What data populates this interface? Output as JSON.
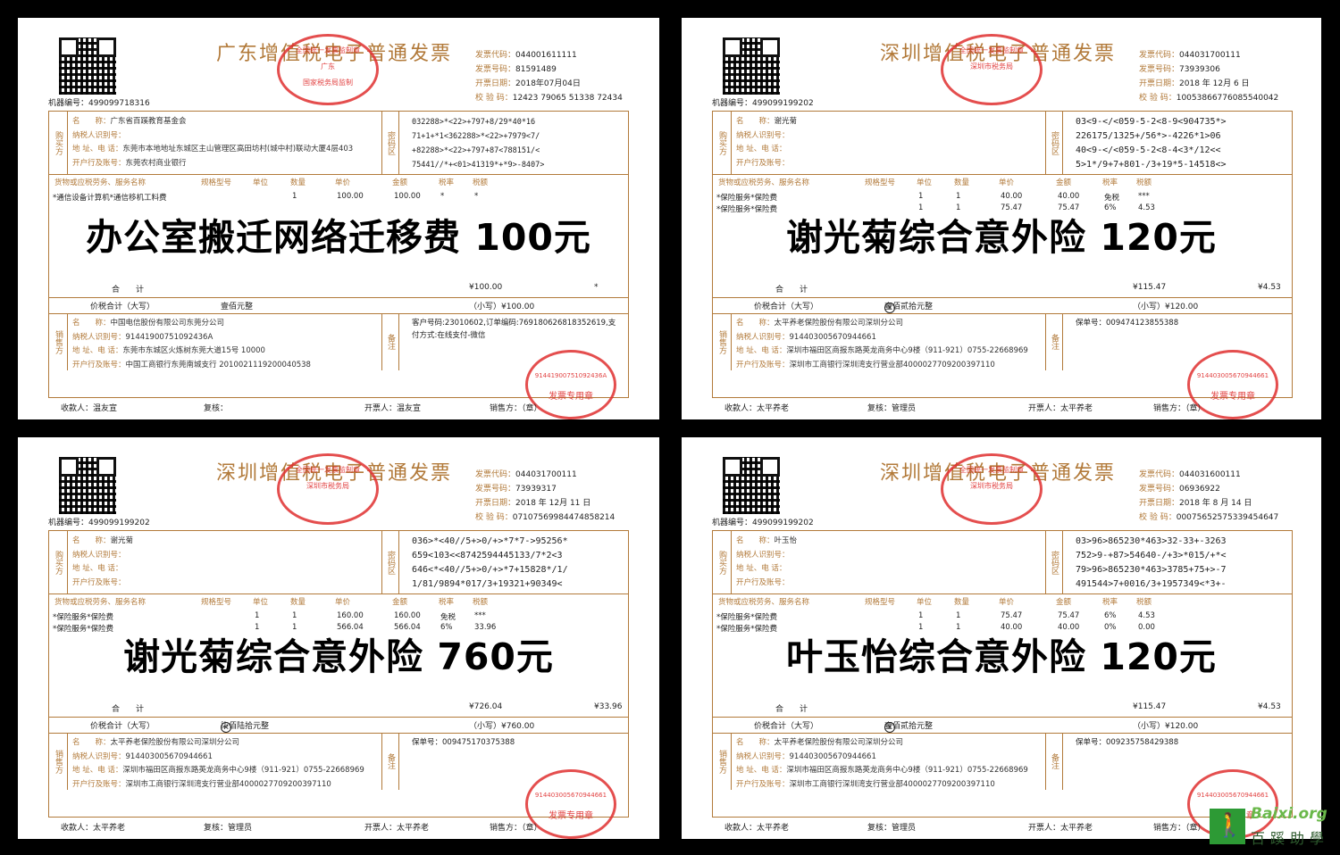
{
  "invoices": [
    {
      "title": "广东增值税电子普通发票",
      "seal_top_lines": [
        "全国统一发票监制章",
        "广东",
        "国家税务局监制"
      ],
      "machine_no": "机器编号：499099718316",
      "meta": [
        {
          "k": "发票代码：",
          "v": "044001611111"
        },
        {
          "k": "发票号码：",
          "v": "81591489"
        },
        {
          "k": "开票日期：",
          "v": "2018年07月04日"
        },
        {
          "k": "校 验 码：",
          "v": "12423 79065 51338 72434"
        }
      ],
      "buyer_label": "购买方",
      "buyer": [
        {
          "k": "名　　称：",
          "v": "广东省百蹊教育基金会"
        },
        {
          "k": "纳税人识别号：",
          "v": ""
        },
        {
          "k": "地 址、电 话：",
          "v": "东莞市本地地址东城区主山管理区高田坊村(城中村)联动大厦4层403"
        },
        {
          "k": "开户行及账号：",
          "v": "东莞农村商业银行"
        }
      ],
      "mi_label": "密码区",
      "cipher": [
        "032288>*<22>+797+8/29*40*16",
        "71+1+*1<362288>*<22>+7979<7/",
        "+82288>*<22>+797+87<788151/<",
        "75441//*+<01>41319*+*9>-8407>"
      ],
      "headers": [
        "货物或应税劳务、服务名称",
        "规格型号",
        "单位",
        "数量",
        "单价",
        "金额",
        "税率",
        "税额"
      ],
      "items": [
        [
          "*通信设备计算机*通信移机工料费",
          "",
          "",
          "1",
          "100.00",
          "100.00",
          "*",
          "*"
        ]
      ],
      "total_label": "合　　计",
      "total_amount": "¥100.00",
      "total_tax": "*",
      "sum_label": "价税合计（大写）",
      "sum_words": "壹佰元整",
      "sum_small": "（小写）¥100.00",
      "seller_label": "销售方",
      "seller": [
        {
          "k": "名　　称：",
          "v": "中国电信股份有限公司东莞分公司"
        },
        {
          "k": "纳税人识别号：",
          "v": "91441900751092436A"
        },
        {
          "k": "地 址、电 话：",
          "v": "东莞市东城区火炼树东莞大道15号 10000"
        },
        {
          "k": "开户行及账号：",
          "v": "中国工商银行东莞南城支行 2010021119200040538"
        }
      ],
      "remark_label": "备注",
      "remark": "客户号码:23010602,订单编码:769180626818352619,支付方式:在线支付-微信",
      "footer": [
        "收款人：温友宣",
        "复核：",
        "开票人：温友宣",
        "销售方：（章）"
      ],
      "seal_bot": [
        "91441900751092436A",
        "发票专用章"
      ],
      "overlay": "办公室搬迁网络迁移费 100元"
    },
    {
      "title": "深圳增值税电子普通发票",
      "seal_top_lines": [
        "全国统一发票监制章",
        "深圳市税务局"
      ],
      "machine_no": "机器编号：499099199202",
      "meta": [
        {
          "k": "发票代码：",
          "v": "044031700111"
        },
        {
          "k": "发票号码：",
          "v": "73939306"
        },
        {
          "k": "开票日期：",
          "v": "2018 年 12月 6 日"
        },
        {
          "k": "校 验 码：",
          "v": "10053866776085540042"
        }
      ],
      "buyer_label": "购买方",
      "buyer": [
        {
          "k": "名　　称：",
          "v": "谢光菊"
        },
        {
          "k": "纳税人识别号：",
          "v": ""
        },
        {
          "k": "地 址、电 话：",
          "v": ""
        },
        {
          "k": "开户行及账号：",
          "v": ""
        }
      ],
      "mi_label": "密码区",
      "cipher": [
        "03<9-</<059-5-2<8-9<904735*>",
        "226175/1325+/56*>-4226*1>06",
        "40<9-</<059-5-2<8-4<3*/12<<",
        "5>1*/9+7+801-/3+19*5-14518<>"
      ],
      "headers": [
        "货物或应税劳务、服务名称",
        "规格型号",
        "单位",
        "数量",
        "单价",
        "金额",
        "税率",
        "税额"
      ],
      "items": [
        [
          "*保险服务*保险费",
          "",
          "1",
          "1",
          "40.00",
          "40.00",
          "免税",
          "***"
        ],
        [
          "*保险服务*保险费",
          "",
          "1",
          "1",
          "75.47",
          "75.47",
          "6%",
          "4.53"
        ]
      ],
      "total_label": "合　　计",
      "total_amount": "¥115.47",
      "total_tax": "¥4.53",
      "sum_label": "价税合计（大写）",
      "sum_words": "壹佰贰拾元整",
      "sum_small": "（小写）¥120.00",
      "seller_label": "销售方",
      "seller": [
        {
          "k": "名　　称：",
          "v": "太平养老保险股份有限公司深圳分公司"
        },
        {
          "k": "纳税人识别号：",
          "v": "914403005670944661"
        },
        {
          "k": "地 址、电 话：",
          "v": "深圳市福田区商报东路英龙商务中心9楼（911-921）0755-22668969"
        },
        {
          "k": "开户行及账号：",
          "v": "深圳市工商银行深圳湾支行营业部4000027709200397110"
        }
      ],
      "remark_label": "备注",
      "remark": "保单号：009474123855388",
      "footer": [
        "收款人：太平养老",
        "复核：管理员",
        "开票人：太平养老",
        "销售方：（章）"
      ],
      "seal_bot": [
        "914403005670944661",
        "发票专用章"
      ],
      "overlay": "谢光菊综合意外险 120元"
    },
    {
      "title": "深圳增值税电子普通发票",
      "seal_top_lines": [
        "全国统一发票监制章",
        "深圳市税务局"
      ],
      "machine_no": "机器编号：499099199202",
      "meta": [
        {
          "k": "发票代码：",
          "v": "044031700111"
        },
        {
          "k": "发票号码：",
          "v": "73939317"
        },
        {
          "k": "开票日期：",
          "v": "2018 年 12月 11 日"
        },
        {
          "k": "校 验 码：",
          "v": "07107569984474858214"
        }
      ],
      "buyer_label": "购买方",
      "buyer": [
        {
          "k": "名　　称：",
          "v": "谢光菊"
        },
        {
          "k": "纳税人识别号：",
          "v": ""
        },
        {
          "k": "地 址、电 话：",
          "v": ""
        },
        {
          "k": "开户行及账号：",
          "v": ""
        }
      ],
      "mi_label": "密码区",
      "cipher": [
        "036>*<40//5+>0/+>*7*7->95256*",
        "659<103<<8742594445133/7*2<3",
        "646<*<40//5+>0/+>*7+15828*/1/",
        "1/81/9894*017/3+19321+90349<"
      ],
      "headers": [
        "货物或应税劳务、服务名称",
        "规格型号",
        "单位",
        "数量",
        "单价",
        "金额",
        "税率",
        "税额"
      ],
      "items": [
        [
          "*保险服务*保险费",
          "",
          "1",
          "1",
          "160.00",
          "160.00",
          "免税",
          "***"
        ],
        [
          "*保险服务*保险费",
          "",
          "1",
          "1",
          "566.04",
          "566.04",
          "6%",
          "33.96"
        ]
      ],
      "total_label": "合　　计",
      "total_amount": "¥726.04",
      "total_tax": "¥33.96",
      "sum_label": "价税合计（大写）",
      "sum_words": "柒佰陆拾元整",
      "sum_small": "（小写）¥760.00",
      "seller_label": "销售方",
      "seller": [
        {
          "k": "名　　称：",
          "v": "太平养老保险股份有限公司深圳分公司"
        },
        {
          "k": "纳税人识别号：",
          "v": "914403005670944661"
        },
        {
          "k": "地 址、电 话：",
          "v": "深圳市福田区商报东路英龙商务中心9楼（911-921）0755-22668969"
        },
        {
          "k": "开户行及账号：",
          "v": "深圳市工商银行深圳湾支行营业部4000027709200397110"
        }
      ],
      "remark_label": "备注",
      "remark": "保单号：009475170375388",
      "footer": [
        "收款人：太平养老",
        "复核：管理员",
        "开票人：太平养老",
        "销售方：（章）"
      ],
      "seal_bot": [
        "914403005670944661",
        "发票专用章"
      ],
      "overlay": "谢光菊综合意外险 760元"
    },
    {
      "title": "深圳增值税电子普通发票",
      "seal_top_lines": [
        "全国统一发票监制章",
        "深圳市税务局"
      ],
      "machine_no": "机器编号：499099199202",
      "meta": [
        {
          "k": "发票代码：",
          "v": "044031600111"
        },
        {
          "k": "发票号码：",
          "v": "06936922"
        },
        {
          "k": "开票日期：",
          "v": "2018 年 8 月 14 日"
        },
        {
          "k": "校 验 码：",
          "v": "00075652575339454647"
        }
      ],
      "buyer_label": "购买方",
      "buyer": [
        {
          "k": "名　　称：",
          "v": "叶玉怡"
        },
        {
          "k": "纳税人识别号：",
          "v": ""
        },
        {
          "k": "地 址、电 话：",
          "v": ""
        },
        {
          "k": "开户行及账号：",
          "v": ""
        }
      ],
      "mi_label": "密码区",
      "cipher": [
        "03>96>865230*463>32-33+-3263",
        "752>9-+87>54640-/+3>*015/+*<",
        "79>96>865230*463>3785+75+>-7",
        "491544>7+0016/3+1957349<*3+-"
      ],
      "headers": [
        "货物或应税劳务、服务名称",
        "规格型号",
        "单位",
        "数量",
        "单价",
        "金额",
        "税率",
        "税额"
      ],
      "items": [
        [
          "*保险服务*保险费",
          "",
          "1",
          "1",
          "75.47",
          "75.47",
          "6%",
          "4.53"
        ],
        [
          "*保险服务*保险费",
          "",
          "1",
          "1",
          "40.00",
          "40.00",
          "0%",
          "0.00"
        ]
      ],
      "total_label": "合　　计",
      "total_amount": "¥115.47",
      "total_tax": "¥4.53",
      "sum_label": "价税合计（大写）",
      "sum_words": "壹佰贰拾元整",
      "sum_small": "（小写）¥120.00",
      "seller_label": "销售方",
      "seller": [
        {
          "k": "名　　称：",
          "v": "太平养老保险股份有限公司深圳分公司"
        },
        {
          "k": "纳税人识别号：",
          "v": "914403005670944661"
        },
        {
          "k": "地 址、电 话：",
          "v": "深圳市福田区商报东路英龙商务中心9楼（911-921）0755-22668969"
        },
        {
          "k": "开户行及账号：",
          "v": "深圳市工商银行深圳湾支行营业部4000027709200397110"
        }
      ],
      "remark_label": "备注",
      "remark": "保单号：009235758429388",
      "footer": [
        "收款人：太平养老",
        "复核：管理员",
        "开票人：太平养老",
        "销售方：（章）"
      ],
      "seal_bot": [
        "914403005670944661",
        "发票专用章"
      ],
      "overlay": "叶玉怡综合意外险 120元"
    }
  ],
  "watermark": {
    "en": "Baixi.org",
    "cn": "百蹊助學"
  }
}
